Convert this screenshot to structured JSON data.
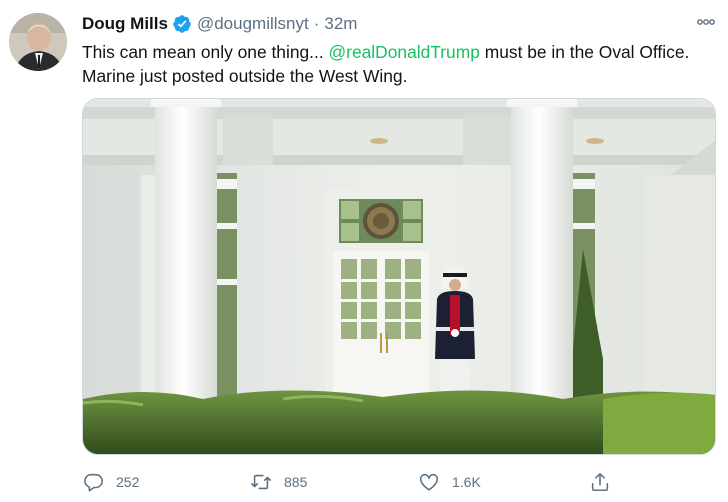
{
  "tweet": {
    "author_name": "Doug Mills",
    "handle": "@dougmillsnyt",
    "separator": "·",
    "time": "32m",
    "text_before": "This can mean only one thing... ",
    "mention": "@realDonaldTrump",
    "text_after": " must be in the Oval Office. Marine just posted outside the West Wing."
  },
  "icons": {
    "verified": "verified-badge-icon",
    "more": "more-options-icon",
    "reply": "reply-icon",
    "retweet": "retweet-icon",
    "like": "like-heart-icon",
    "share": "share-icon"
  },
  "actions": {
    "reply_count": "252",
    "retweet_count": "885",
    "like_count": "1.6K"
  },
  "colors": {
    "verified": "#1da1f2",
    "mention": "#17bf63",
    "secondary_text": "#5b7083"
  }
}
